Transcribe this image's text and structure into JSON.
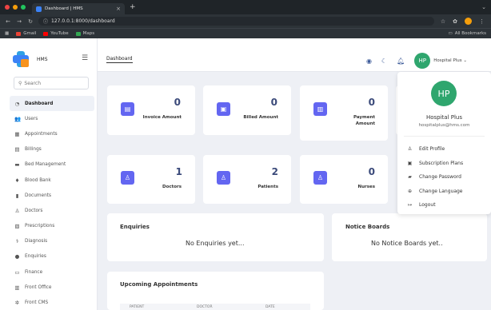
{
  "browser": {
    "tab_title": "Dashboard | HMS",
    "url": "127.0.0.1:8000/dashboard",
    "bookmarks": [
      "Gmail",
      "YouTube",
      "Maps"
    ],
    "all_bookmarks": "All Bookmarks",
    "colors": {
      "dot_close": "#ef4444",
      "dot_min": "#f59e0b",
      "dot_max": "#22c55e"
    }
  },
  "app": {
    "brand": "HMS",
    "search_placeholder": "Search",
    "breadcrumb": "Dashboard",
    "user_initials": "HP",
    "user_name": "Hospital Plus",
    "accent": "#6366f1",
    "avatar_color": "#2fa66e"
  },
  "sidebar": {
    "items": [
      {
        "label": "Dashboard",
        "icon": "dashboard-icon",
        "active": true
      },
      {
        "label": "Users",
        "icon": "users-icon"
      },
      {
        "label": "Appointments",
        "icon": "calendar-icon"
      },
      {
        "label": "Billings",
        "icon": "billing-icon"
      },
      {
        "label": "Bed Management",
        "icon": "bed-icon"
      },
      {
        "label": "Blood Bank",
        "icon": "blood-drop-icon"
      },
      {
        "label": "Documents",
        "icon": "document-icon"
      },
      {
        "label": "Doctors",
        "icon": "doctor-icon"
      },
      {
        "label": "Prescriptions",
        "icon": "prescription-icon"
      },
      {
        "label": "Diagnosis",
        "icon": "diagnosis-icon"
      },
      {
        "label": "Enquiries",
        "icon": "enquiry-icon"
      },
      {
        "label": "Finance",
        "icon": "finance-icon"
      },
      {
        "label": "Front Office",
        "icon": "front-office-icon"
      },
      {
        "label": "Front CMS",
        "icon": "cms-icon"
      }
    ]
  },
  "stats": [
    {
      "value": "0",
      "label": "Invoice Amount",
      "icon": "invoice-icon"
    },
    {
      "value": "0",
      "label": "Billed Amount",
      "icon": "billed-icon"
    },
    {
      "value": "0",
      "label_line1": "Payment",
      "label_line2": "Amount",
      "icon": "payment-icon"
    },
    {
      "value": "1",
      "label": "Doctors",
      "icon": "doctor-icon"
    },
    {
      "value": "2",
      "label": "Patients",
      "icon": "patient-icon"
    },
    {
      "value": "0",
      "label": "Nurses",
      "icon": "nurse-icon"
    }
  ],
  "sections": {
    "enquiries_title": "Enquiries",
    "enquiries_empty": "No Enquiries yet...",
    "notice_title": "Notice Boards",
    "notice_empty": "No Notice Boards yet..",
    "appointments_title": "Upcoming Appointments",
    "appointments_columns": [
      "PATIENT",
      "DOCTOR",
      "DATE"
    ]
  },
  "profile_menu": {
    "initials": "HP",
    "name": "Hospital Plus",
    "email": "hospitalplus@hms.com",
    "items": [
      {
        "label": "Edit Profile",
        "icon": "user-icon"
      },
      {
        "label": "Subscription Plans",
        "icon": "card-icon"
      },
      {
        "label": "Change Password",
        "icon": "lock-icon"
      },
      {
        "label": "Change Language",
        "icon": "globe-icon"
      },
      {
        "label": "Logout",
        "icon": "logout-icon"
      }
    ]
  }
}
